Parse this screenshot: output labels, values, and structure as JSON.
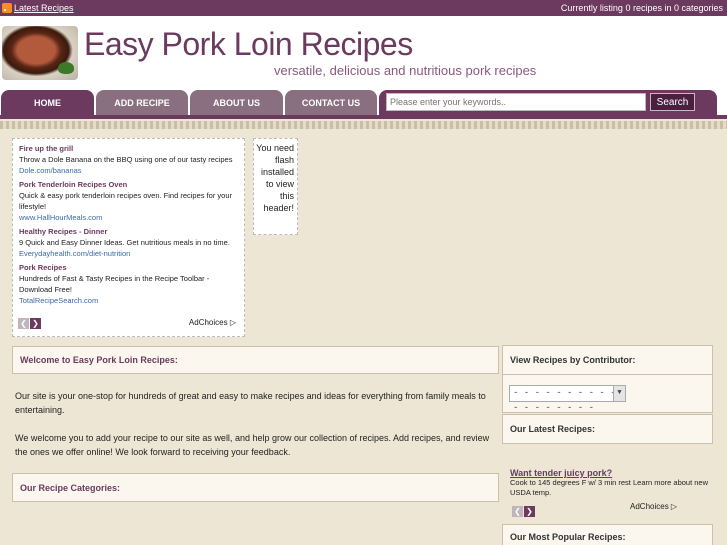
{
  "topbar": {
    "latest_link": "Latest Recipes",
    "status_text": "Currently listing 0 recipes in 0 categories"
  },
  "header": {
    "site_title": "Easy Pork Loin Recipes",
    "tagline": "versatile, delicious and nutritious pork recipes"
  },
  "nav": {
    "tabs": [
      {
        "label": "HOME"
      },
      {
        "label": "ADD RECIPE"
      },
      {
        "label": "ABOUT US"
      },
      {
        "label": "CONTACT US"
      }
    ],
    "search_placeholder": "Please enter your keywords..",
    "search_button": "Search"
  },
  "ads": {
    "items": [
      {
        "title": "Fire up the grill",
        "text": "Throw a Dole Banana on the BBQ using one of our tasty recipes",
        "url": "Dole.com/bananas"
      },
      {
        "title": "Pork Tenderloin Recipes Oven",
        "text": "Quick & easy pork tenderloin recipes oven. Find recipes for your lifestyle!",
        "url": "www.HallHourMeals.com"
      },
      {
        "title": "Healthy Recipes - Dinner",
        "text": "9 Quick and Easy Dinner Ideas. Get nutritious meals in no time.",
        "url": "Everydayhealth.com/diet-nutrition"
      },
      {
        "title": "Pork Recipes",
        "text": "Hundreds of Fast & Tasty Recipes in the Recipe Toolbar - Download Free!",
        "url": "TotalRecipeSearch.com"
      }
    ],
    "adchoices": "AdChoices"
  },
  "flash_message": "You need flash installed to view this header!",
  "welcome": {
    "heading": "Welcome to Easy Pork Loin Recipes:",
    "paragraph1": "Our site is your one-stop for hundreds of great and easy to make recipes and ideas for everything from family meals to entertaining.",
    "paragraph2": "We welcome you to add your recipe to our site as well, and help grow our collection of recipes. Add recipes, and review the ones we offer online! We look forward to receiving your feedback."
  },
  "categories": {
    "heading": "Our Recipe Categories:"
  },
  "sidebar": {
    "contributor_heading": "View Recipes by Contributor:",
    "contributor_selected": "- - - - - - - - - - - - - - - - - -",
    "latest_heading": "Our Latest Recipes:",
    "latest_ad": {
      "title": "Want tender juicy pork?",
      "text": "Cook to 145 degrees F w/ 3 min rest Learn more about new USDA temp."
    },
    "latest_adchoices": "AdChoices",
    "popular_heading": "Our Most Popular Recipes:"
  },
  "colors": {
    "brand_purple": "#6b3a5e",
    "tab_inactive": "#8a6f80",
    "page_background": "#ede6d4",
    "link_blue": "#3a6aa8"
  }
}
